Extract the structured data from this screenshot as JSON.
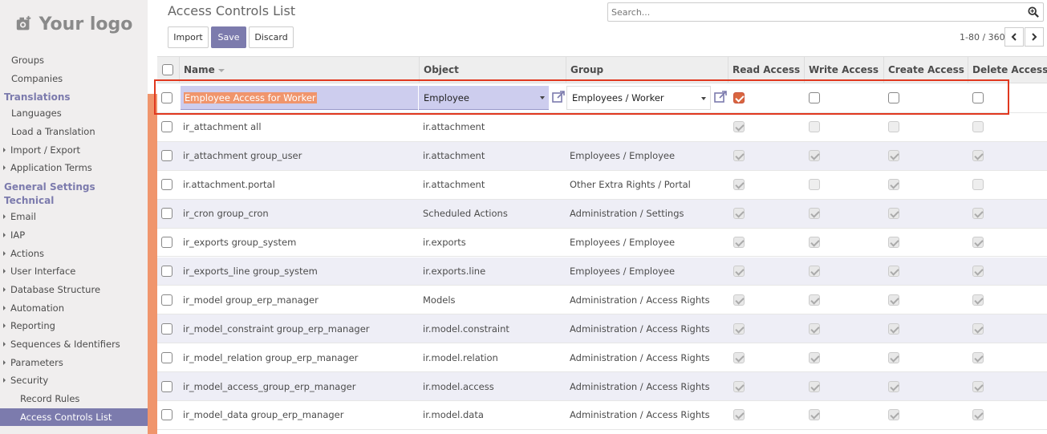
{
  "logo_text": "Your logo",
  "sidebar": {
    "items_top": [
      "Groups",
      "Companies"
    ],
    "translations_header": "Translations",
    "translations_items": [
      {
        "label": "Languages",
        "caret": false
      },
      {
        "label": "Load a Translation",
        "caret": false
      },
      {
        "label": "Import / Export",
        "caret": true
      },
      {
        "label": "Application Terms",
        "caret": true
      }
    ],
    "general_settings_header": "General Settings",
    "technical_header": "Technical",
    "technical_items": [
      {
        "label": "Email",
        "caret": true
      },
      {
        "label": "IAP",
        "caret": true
      },
      {
        "label": "Actions",
        "caret": true
      },
      {
        "label": "User Interface",
        "caret": true
      },
      {
        "label": "Database Structure",
        "caret": true
      },
      {
        "label": "Automation",
        "caret": true
      },
      {
        "label": "Reporting",
        "caret": true
      },
      {
        "label": "Sequences & Identifiers",
        "caret": true
      },
      {
        "label": "Parameters",
        "caret": true
      },
      {
        "label": "Security",
        "caret": true,
        "open": true
      }
    ],
    "security_items": [
      {
        "label": "Record Rules",
        "active": false
      },
      {
        "label": "Access Controls List",
        "active": true
      }
    ]
  },
  "header": {
    "title": "Access Controls List",
    "search_placeholder": "Search...",
    "import_label": "Import",
    "save_label": "Save",
    "discard_label": "Discard",
    "pager": "1-80 / 360"
  },
  "columns": [
    "Name",
    "Object",
    "Group",
    "Read Access",
    "Write Access",
    "Create Access",
    "Delete Access"
  ],
  "edit_row": {
    "name": "Employee Access for Worker",
    "object": "Employee",
    "group": "Employees / Worker",
    "read": true,
    "write": false,
    "create": false,
    "delete": false
  },
  "rows": [
    {
      "name": "ir_attachment all",
      "object": "ir.attachment",
      "group": "",
      "read": true,
      "write": false,
      "create": false,
      "delete": false
    },
    {
      "name": "ir_attachment group_user",
      "object": "ir.attachment",
      "group": "Employees / Employee",
      "read": true,
      "write": true,
      "create": true,
      "delete": true
    },
    {
      "name": "ir.attachment.portal",
      "object": "ir.attachment",
      "group": "Other Extra Rights / Portal",
      "read": true,
      "write": false,
      "create": true,
      "delete": false
    },
    {
      "name": "ir_cron group_cron",
      "object": "Scheduled Actions",
      "group": "Administration / Settings",
      "read": true,
      "write": true,
      "create": true,
      "delete": true
    },
    {
      "name": "ir_exports group_system",
      "object": "ir.exports",
      "group": "Employees / Employee",
      "read": true,
      "write": true,
      "create": true,
      "delete": true
    },
    {
      "name": "ir_exports_line group_system",
      "object": "ir.exports.line",
      "group": "Employees / Employee",
      "read": true,
      "write": true,
      "create": true,
      "delete": true
    },
    {
      "name": "ir_model group_erp_manager",
      "object": "Models",
      "group": "Administration / Access Rights",
      "read": true,
      "write": true,
      "create": true,
      "delete": true
    },
    {
      "name": "ir_model_constraint group_erp_manager",
      "object": "ir.model.constraint",
      "group": "Administration / Access Rights",
      "read": true,
      "write": true,
      "create": true,
      "delete": true
    },
    {
      "name": "ir_model_relation group_erp_manager",
      "object": "ir.model.relation",
      "group": "Administration / Access Rights",
      "read": true,
      "write": true,
      "create": true,
      "delete": true
    },
    {
      "name": "ir_model_access_group_erp_manager",
      "object": "ir.model.access",
      "group": "Administration / Access Rights",
      "read": true,
      "write": true,
      "create": true,
      "delete": true
    },
    {
      "name": "ir_model_data group_erp_manager",
      "object": "ir.model.data",
      "group": "Administration / Access Rights",
      "read": true,
      "write": true,
      "create": true,
      "delete": true
    }
  ],
  "colors": {
    "accent": "#7c7bad",
    "highlight": "#f0956c",
    "annotation_box": "#e0381f"
  }
}
